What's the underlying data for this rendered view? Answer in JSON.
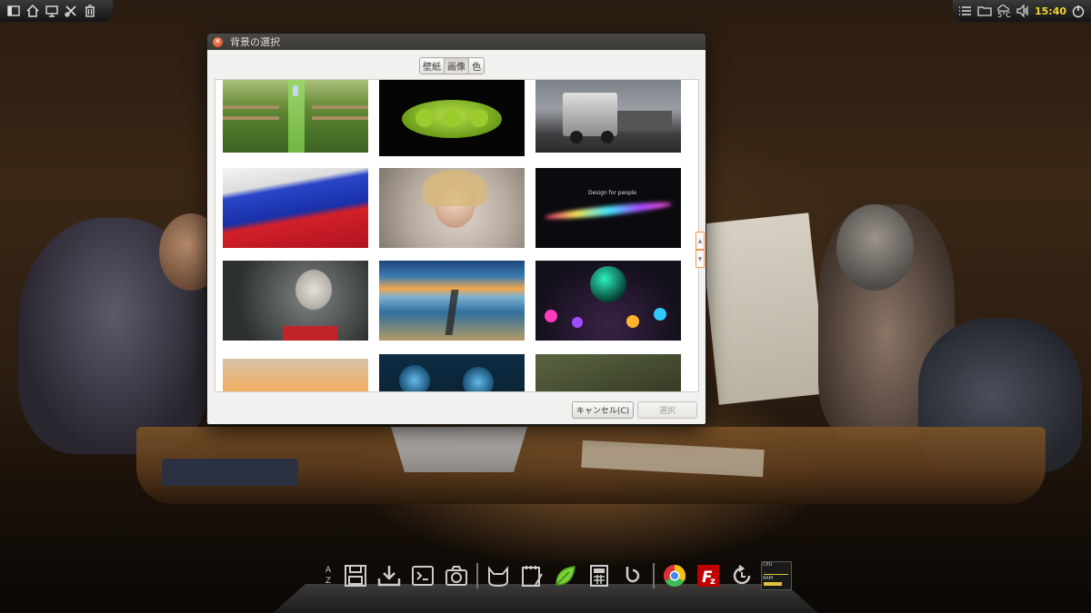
{
  "top_panel": {
    "left_icons": [
      "window-icon",
      "home-icon",
      "monitor-icon",
      "settings-icon",
      "trash-icon"
    ],
    "right_icons": [
      "menu-icon",
      "folder-icon",
      "weather-icon",
      "volume-icon",
      "power-icon"
    ],
    "weather_temp": "5°C",
    "clock": "15:40"
  },
  "dialog": {
    "title": "背景の選択",
    "tabs": [
      {
        "label": "壁紙",
        "active": false
      },
      {
        "label": "画像",
        "active": true
      },
      {
        "label": "色",
        "active": false
      }
    ],
    "thumbnails": [
      "green-field-gate",
      "green-peas",
      "truck",
      "russian-flag",
      "fantasy-woman",
      "design-for-people",
      "woman-bottle",
      "pier-sunset",
      "glowing-spheres",
      "sunset-flower",
      "blue-globes",
      "soldier"
    ],
    "thumbnail_caption": "Design for people",
    "cancel_label": "キャンセル(C)",
    "select_label": "選択"
  },
  "dock": {
    "items": [
      "az-sort-icon",
      "save-icon",
      "download-icon",
      "terminal-icon",
      "camera-icon",
      "cat-icon",
      "notepad-icon",
      "leaf-icon",
      "calculator-icon",
      "refresh-icon",
      "chrome-icon",
      "filezilla-icon",
      "update-icon",
      "system-monitor-icon"
    ],
    "az_label": "A\nZ",
    "monitor_labels": [
      "CPU",
      "RAM"
    ]
  }
}
